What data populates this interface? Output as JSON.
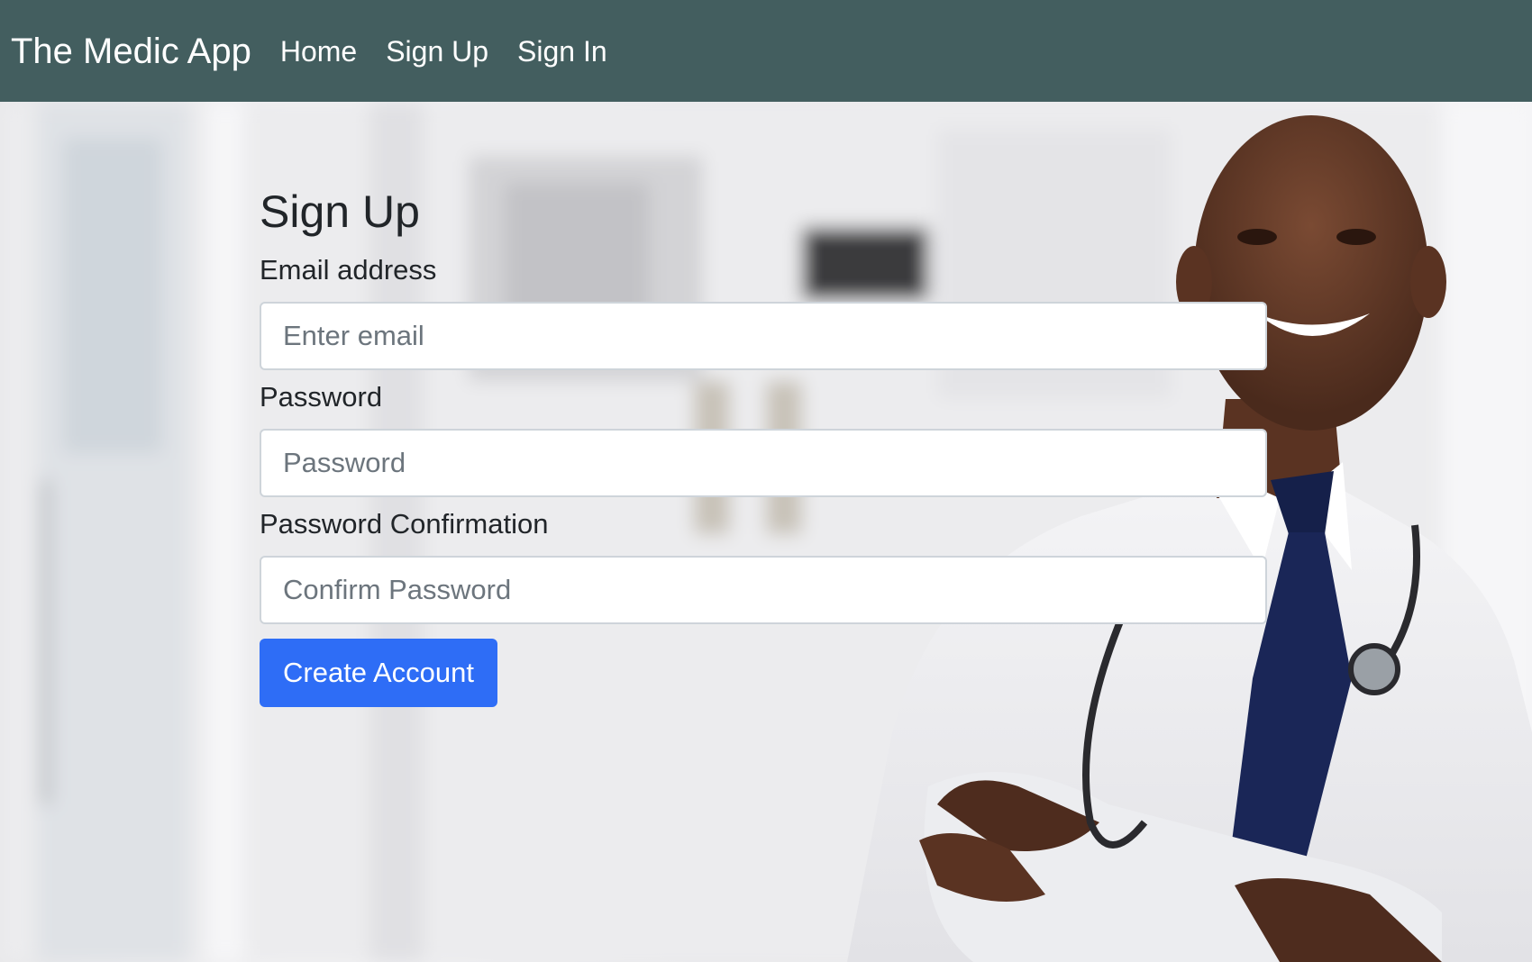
{
  "nav": {
    "brand": "The Medic App",
    "links": [
      "Home",
      "Sign Up",
      "Sign In"
    ]
  },
  "form": {
    "title": "Sign Up",
    "email_label": "Email address",
    "email_placeholder": "Enter email",
    "password_label": "Password",
    "password_placeholder": "Password",
    "confirm_label": "Password Confirmation",
    "confirm_placeholder": "Confirm Password",
    "submit_label": "Create Account"
  },
  "colors": {
    "navbar": "#435e5f",
    "primary_button": "#2e6df6"
  }
}
